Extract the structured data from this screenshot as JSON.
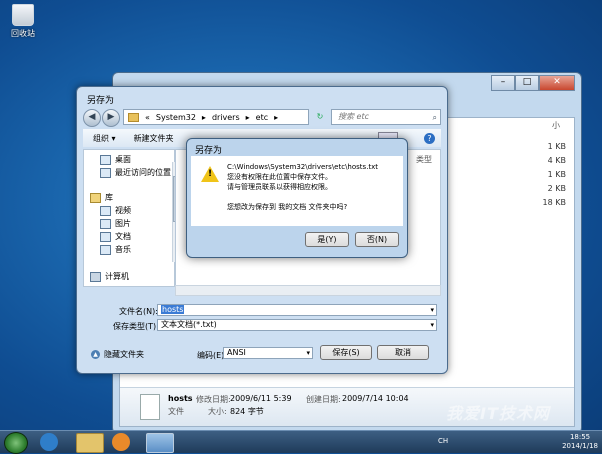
{
  "desktop": {
    "recycle_bin_label": "回收站"
  },
  "background_window": {
    "ctrl_min": "–",
    "ctrl_max": "□",
    "ctrl_close": "✕",
    "column_header": "小",
    "sizes": [
      "1 KB",
      "4 KB",
      "1 KB",
      "2 KB",
      "18 KB"
    ],
    "info": {
      "name": "hosts",
      "modified_label": "修改日期:",
      "modified": "2009/6/11 5:39",
      "created_label": "创建日期:",
      "created": "2009/7/14 10:04",
      "type": "文件",
      "size_label": "大小:",
      "size": "824 字节"
    }
  },
  "save_dialog": {
    "title": "另存为",
    "back": "◀",
    "forward": "▶",
    "breadcrumb": [
      "«",
      "System32",
      "▸",
      "drivers",
      "▸",
      "etc",
      "▸"
    ],
    "refresh": "↻",
    "search_placeholder": "搜索 etc",
    "search_icon": "⌕",
    "toolbar": {
      "organize": "组织 ▾",
      "new_folder": "新建文件夹",
      "help": "?"
    },
    "nav_items": [
      "桌面",
      "最近访问的位置",
      "库",
      "视频",
      "图片",
      "文档",
      "音乐",
      "计算机"
    ],
    "files_header": "类型",
    "filename_label": "文件名(N):",
    "filename_value": "hosts",
    "savetype_label": "保存类型(T):",
    "savetype_value": "文本文档(*.txt)",
    "hide_folders": "隐藏文件夹",
    "encoding_label": "编码(E):",
    "encoding_value": "ANSI",
    "save_button": "保存(S)",
    "cancel_button": "取消",
    "dropdown_arrow": "▾"
  },
  "alert": {
    "title": "另存为",
    "icon_glyph": "!",
    "lines": [
      "C:\\Windows\\System32\\drivers\\etc\\hosts.txt",
      "您没有权限在此位置中保存文件。",
      "请与管理员联系以获得相应权限。",
      "",
      "您想改为保存到 我的文档 文件夹中吗?"
    ],
    "yes_button": "是(Y)",
    "no_button": "否(N)"
  },
  "taskbar": {
    "tray_lang": "CH",
    "time": "18:55",
    "date": "2014/1/18"
  },
  "watermark": "我爱IT技术网"
}
